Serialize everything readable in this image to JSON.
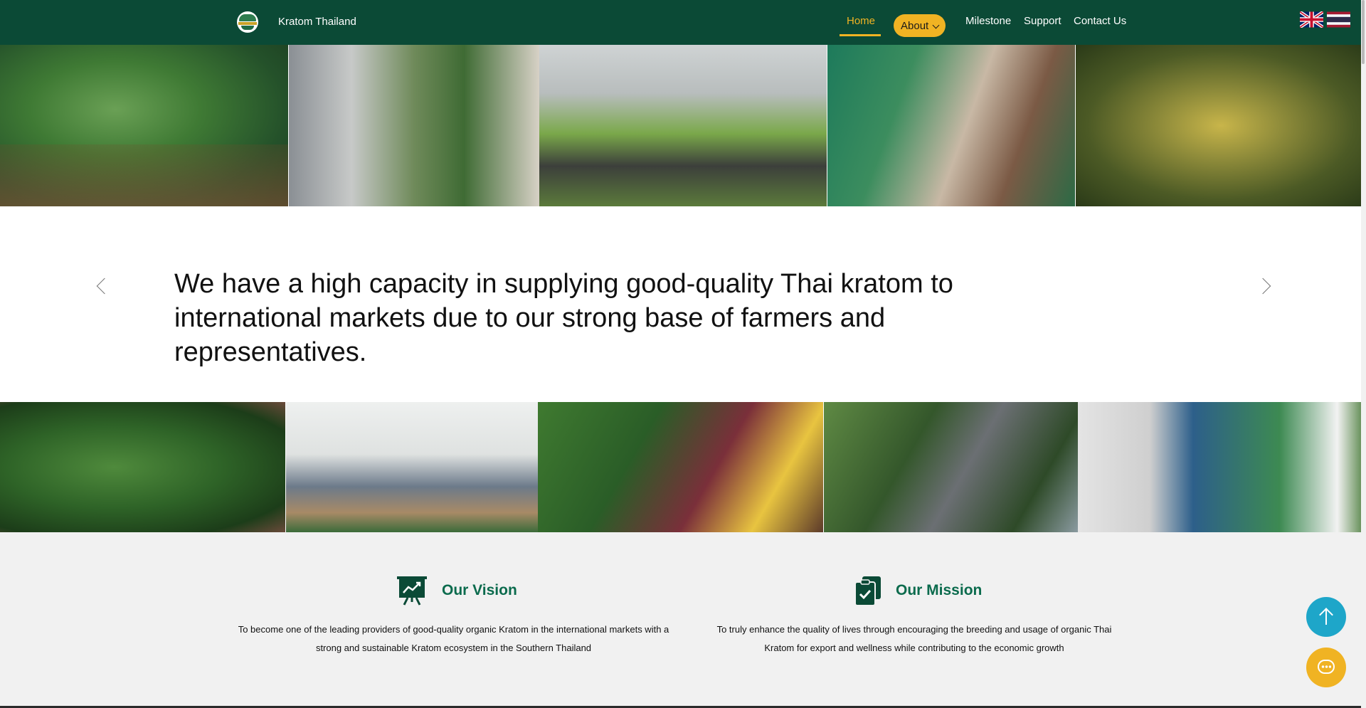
{
  "nav": {
    "brand": "Kratom Thailand",
    "items": [
      {
        "label": "Home",
        "active": true
      },
      {
        "label": "About",
        "has_dropdown": true
      },
      {
        "label": "Milestone"
      },
      {
        "label": "Support"
      },
      {
        "label": "Contact Us"
      }
    ],
    "languages": [
      "uk-flag-icon",
      "thailand-flag-icon"
    ]
  },
  "carousel": {
    "text": "We have a high capacity in supplying good-quality Thai kratom to international markets due to our strong base of farmers and representatives.",
    "prev_icon": "chevron-left-icon",
    "next_icon": "chevron-right-icon"
  },
  "vision": {
    "title": "Our Vision",
    "text": "To become one of the leading providers of good-quality organic Kratom in the international markets with a strong and sustainable Kratom ecosystem in the Southern Thailand"
  },
  "mission": {
    "title": "Our Mission",
    "text": "To truly enhance the quality of lives through encouraging the breeding and usage of organic Thai Kratom for export and wellness while contributing to the economic growth"
  },
  "floating": {
    "scroll_top_icon": "arrow-up-icon",
    "chat_icon": "chat-icon"
  },
  "colors": {
    "nav_bg": "#0b4a36",
    "accent": "#f0b323",
    "brand_green": "#0b6b4d",
    "section_bg": "#f1f1f1",
    "scroll_btn": "#1ea6c9"
  }
}
